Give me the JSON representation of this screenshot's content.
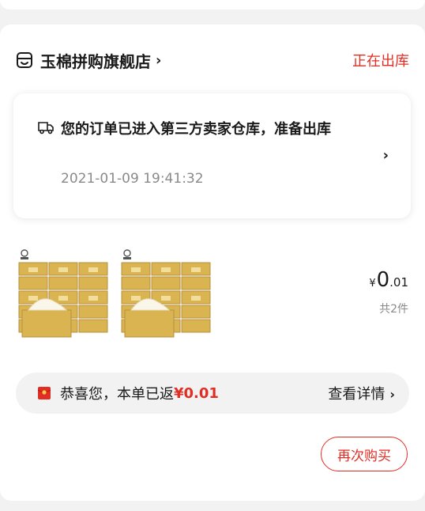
{
  "shop": {
    "name": "玉棉拼购旗舰店",
    "chevron": "›",
    "status": "正在出库",
    "icon": "shop-icon"
  },
  "logistics": {
    "icon": "truck-icon",
    "message": "您的订单已进入第三方卖家仓库，准备出库",
    "time": "2021-01-09 19:41:32",
    "chevron": "›"
  },
  "product": {
    "images": [
      "tissue-pack-image",
      "tissue-pack-image"
    ],
    "price_currency": "¥",
    "price_integer": "0",
    "price_decimal": ".01",
    "count": "共2件"
  },
  "cashback": {
    "icon": "red-packet-icon",
    "text": "恭喜您，本单已返",
    "amount": "¥0.01",
    "link_label": "查看详情",
    "link_chevron": "›"
  },
  "actions": {
    "rebuy_label": "再次购买"
  },
  "colors": {
    "accent": "#e02e24",
    "background": "#f2f2f2",
    "card": "#ffffff"
  }
}
